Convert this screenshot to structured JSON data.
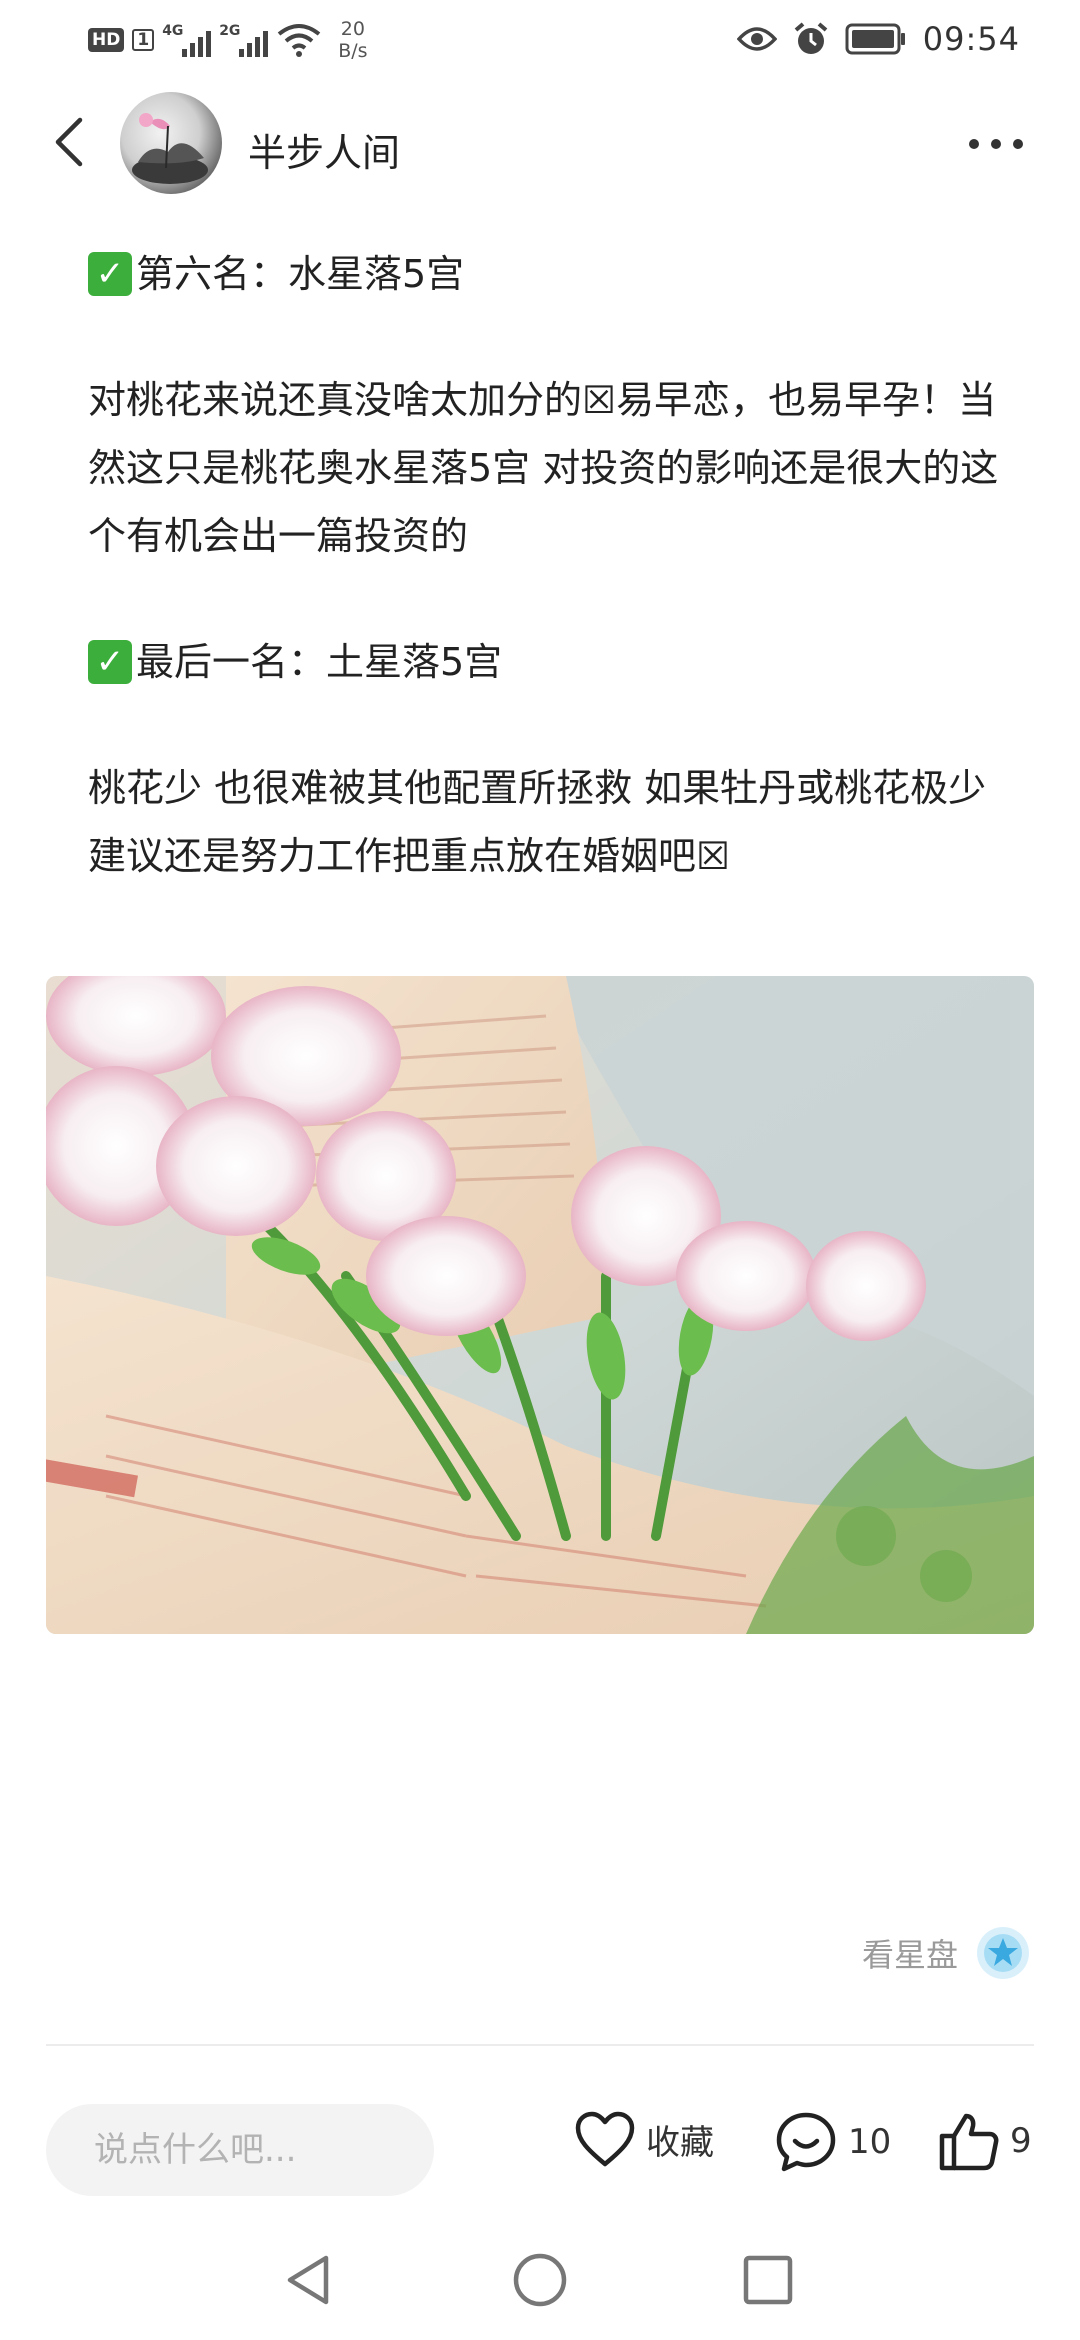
{
  "status_bar": {
    "network_badge": "HD",
    "sim_badge": "1",
    "signal_1_gen": "4G",
    "signal_2_gen": "2G",
    "speed_value": "20",
    "speed_unit": "B/s",
    "time": "09:54"
  },
  "header": {
    "author_name": "半步人间"
  },
  "article": {
    "heading_1": "第六名：水星落5宫",
    "paragraph_1": "对桃花来说还真没啥太加分的☒易早恋，也易早孕！当然这只是桃花奥水星落5宫 对投资的影响还是很大的这个有机会出一篇投资的",
    "heading_2": "最后一名：土星落5宫",
    "paragraph_2": "桃花少 也很难被其他配置所拯救 如果牡丹或桃花极少 建议还是努力工作把重点放在婚姻吧☒",
    "check_glyph": "✓"
  },
  "chart_link": {
    "label": "看星盘"
  },
  "action_bar": {
    "comment_placeholder": "说点什么吧...",
    "favorite_label": "收藏",
    "comment_count": "10",
    "like_count": "9"
  },
  "colors": {
    "check_green": "#3cae3c",
    "chart_icon_blue": "#4ab8ea",
    "muted_text": "#9a9a9a"
  }
}
